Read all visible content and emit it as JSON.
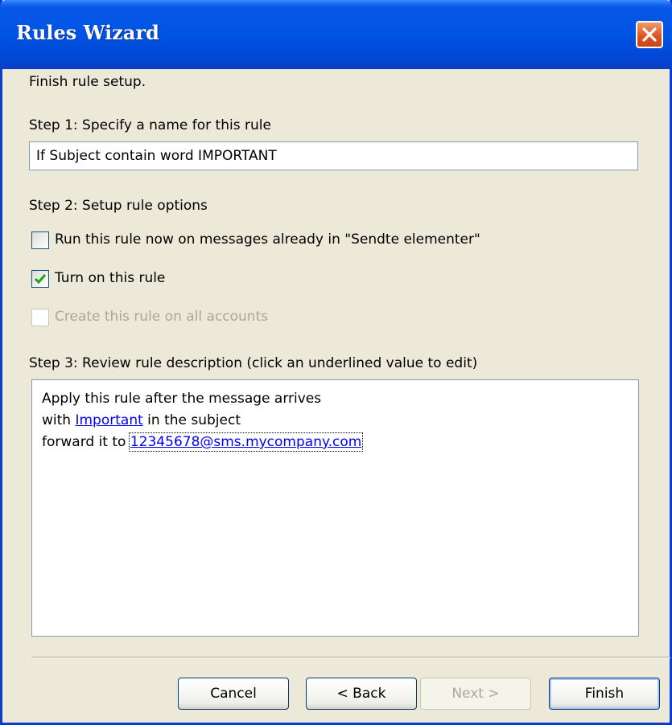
{
  "window": {
    "title": "Rules Wizard"
  },
  "intro": "Finish rule setup.",
  "step1": {
    "label": "Step 1: Specify a name for this rule",
    "name_value": "If Subject contain word IMPORTANT"
  },
  "step2": {
    "label": "Step 2: Setup rule options",
    "options": [
      {
        "label": "Run this rule now on messages already in \"Sendte elementer\"",
        "checked": false,
        "enabled": true
      },
      {
        "label": "Turn on this rule",
        "checked": true,
        "enabled": true
      },
      {
        "label": "Create this rule on all accounts",
        "checked": false,
        "enabled": false
      }
    ]
  },
  "step3": {
    "label": "Step 3: Review rule description (click an underlined value to edit)",
    "line1": "Apply this rule after the message arrives",
    "line2_prefix": "with ",
    "line2_link": "Important",
    "line2_suffix": " in the subject",
    "line3_prefix": "forward it to ",
    "line3_link": "12345678@sms.mycompany.com"
  },
  "buttons": {
    "cancel": "Cancel",
    "back": "< Back",
    "next": "Next >",
    "finish": "Finish"
  }
}
